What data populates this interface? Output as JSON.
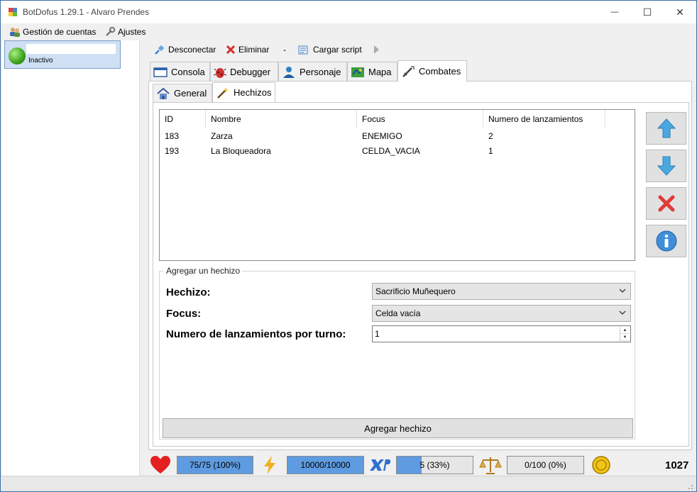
{
  "window": {
    "title": "BotDofus 1.29.1 - Alvaro Prendes",
    "minimize": "—",
    "maximize": "☐",
    "close": "✕"
  },
  "menu": {
    "accounts": "Gestión de cuentas",
    "settings": "Ajustes"
  },
  "account": {
    "status": "Inactivo"
  },
  "toolbar": {
    "disconnect": "Desconectar",
    "delete": "Eliminar",
    "separator": "-",
    "load_script": "Cargar script"
  },
  "tabs": [
    {
      "label": "Consola",
      "icon": "console-icon"
    },
    {
      "label": "Debugger",
      "icon": "bug-icon"
    },
    {
      "label": "Personaje",
      "icon": "character-icon"
    },
    {
      "label": "Mapa",
      "icon": "map-icon"
    },
    {
      "label": "Combates",
      "icon": "sword-icon"
    }
  ],
  "subtabs": [
    {
      "label": "General",
      "icon": "home-icon"
    },
    {
      "label": "Hechizos",
      "icon": "wand-icon"
    }
  ],
  "spell_list": {
    "columns": [
      "ID",
      "Nombre",
      "Focus",
      "Numero de lanzamientos"
    ],
    "rows": [
      {
        "id": "183",
        "name": "Zarza",
        "focus": "ENEMIGO",
        "casts": "2"
      },
      {
        "id": "193",
        "name": "La Bloqueadora",
        "focus": "CELDA_VACIA",
        "casts": "1"
      }
    ]
  },
  "add_spell": {
    "legend": "Agregar un hechizo",
    "spell_label": "Hechizo:",
    "spell_value": "Sacrificio Muñequero",
    "focus_label": "Focus:",
    "focus_value": "Celda vacía",
    "casts_label": "Numero de lanzamientos por turno:",
    "casts_value": "1",
    "button": "Agregar hechizo"
  },
  "status": {
    "hp_text": "75/75 (100%)",
    "hp_fraction": 1.0,
    "energy_text": "10000/10000",
    "energy_fraction": 1.0,
    "xp_text": "5 (33%)",
    "xp_fraction": 0.33,
    "pods_text": "0/100 (0%)",
    "pods_fraction": 0.0,
    "kamas": "1027"
  },
  "colors": {
    "bar_fill": "#5e9be0",
    "selected_account": "#cfe0f5",
    "online_dot": "#3aa01c"
  }
}
